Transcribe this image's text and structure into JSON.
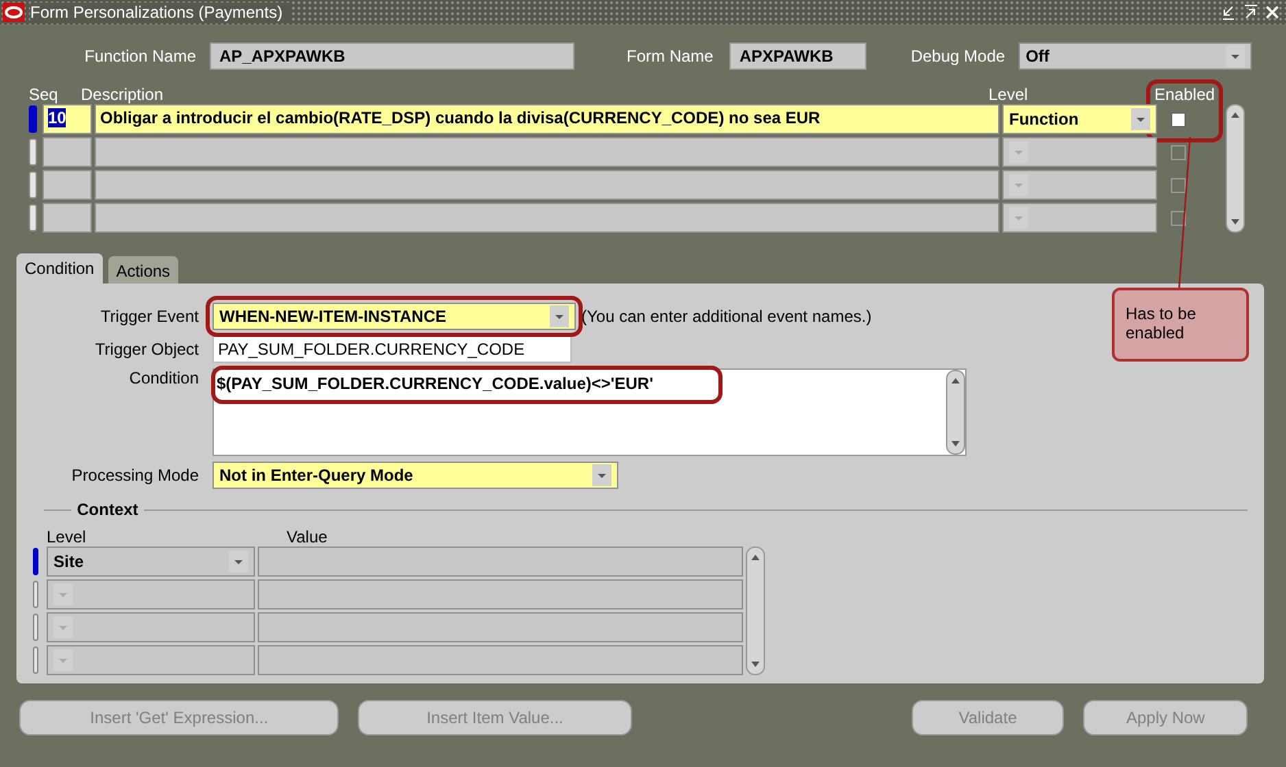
{
  "window": {
    "title": "Form Personalizations (Payments)"
  },
  "header": {
    "function_name": {
      "label": "Function Name",
      "value": "AP_APXPAWKB"
    },
    "form_name": {
      "label": "Form Name",
      "value": "APXPAWKB"
    },
    "debug_mode": {
      "label": "Debug Mode",
      "value": "Off"
    }
  },
  "rules": {
    "columns": [
      {
        "label": "Seq",
        "highlighted": false
      },
      {
        "label": "Description",
        "highlighted": false
      },
      {
        "label": "Level",
        "highlighted": false
      },
      {
        "label": "Enabled",
        "highlighted": true
      }
    ],
    "rows": [
      {
        "seq": "10",
        "description": "Obligar a introducir el cambio(RATE_DSP) cuando la divisa(CURRENCY_CODE) no sea EUR",
        "level": "Function",
        "enabled": false,
        "selected": true
      },
      {
        "enabled": false,
        "selected": false
      },
      {
        "enabled": false,
        "selected": false
      },
      {
        "enabled": false,
        "selected": false
      }
    ]
  },
  "tabs": [
    {
      "label": "Condition",
      "selected": true
    },
    {
      "label": "Actions",
      "selected": false
    }
  ],
  "condition": {
    "trigger_event": {
      "label": "Trigger Event",
      "value": "WHEN-NEW-ITEM-INSTANCE",
      "hint": "(You can enter additional event names.)",
      "highlighted": true
    },
    "trigger_object": {
      "label": "Trigger Object",
      "value": "PAY_SUM_FOLDER.CURRENCY_CODE"
    },
    "condition": {
      "label": "Condition",
      "value": "$(PAY_SUM_FOLDER.CURRENCY_CODE.value)<>'EUR'",
      "highlighted": true
    },
    "processing_mode": {
      "label": "Processing Mode",
      "value": "Not in Enter-Query Mode"
    }
  },
  "context": {
    "title": "Context",
    "columns": [
      "Level",
      "Value"
    ],
    "rows": [
      {
        "level": "Site",
        "selected": true
      },
      {
        "selected": false
      },
      {
        "selected": false
      },
      {
        "selected": false
      }
    ]
  },
  "buttons": [
    {
      "label": "Insert 'Get' Expression...",
      "disabled": true
    },
    {
      "label": "Insert Item Value...",
      "disabled": true
    },
    {
      "label": "Validate",
      "disabled": true
    },
    {
      "label": "Apply Now",
      "disabled": true
    }
  ],
  "callout": {
    "text": "Has to be enabled"
  }
}
